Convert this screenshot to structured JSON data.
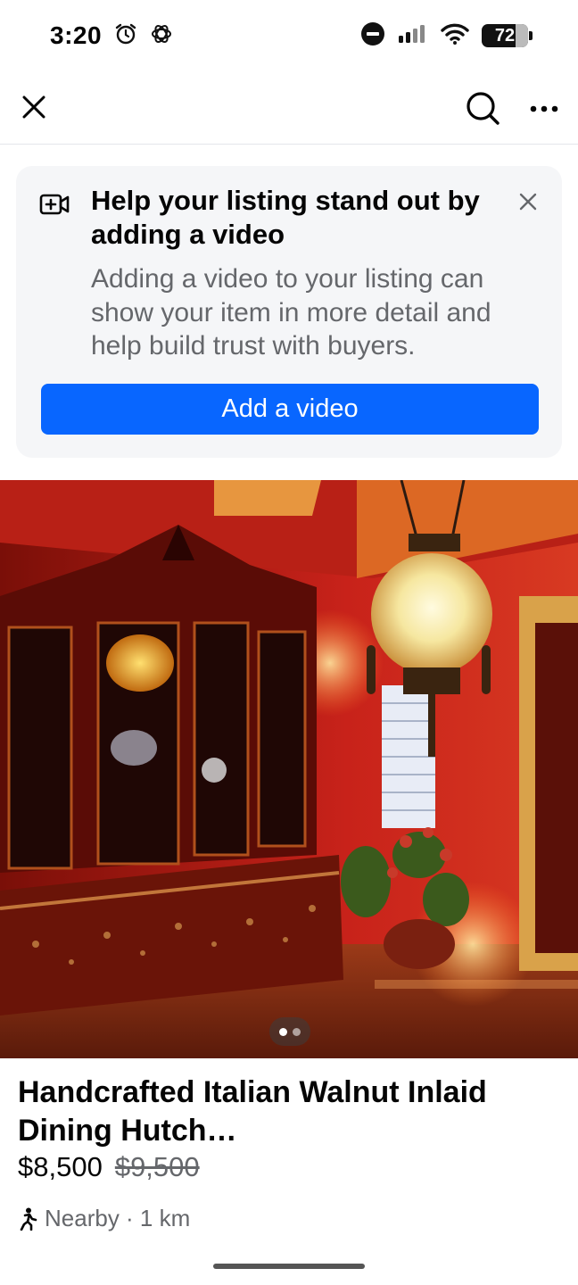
{
  "status_bar": {
    "time": "3:20",
    "battery": "72",
    "icons": [
      "alarm-icon",
      "chatgpt-icon",
      "dnd-icon",
      "signal-icon",
      "wifi-icon",
      "battery-icon"
    ]
  },
  "top_bar": {
    "icons": [
      "close-icon",
      "search-icon",
      "more-icon"
    ]
  },
  "promo": {
    "title": "Help your listing stand out by adding a video",
    "body": "Adding a video to your listing can show your item in more detail and help build trust with buyers.",
    "button_label": "Add a video",
    "icons": [
      "video-add-icon",
      "dismiss-icon"
    ],
    "accent_color": "#0866ff"
  },
  "photo": {
    "description_icon": "listing-photo",
    "page_count": 2,
    "current_page": 1
  },
  "listing": {
    "title": "Handcrafted Italian Walnut Inlaid Dining Hutch…",
    "price": "$8,500",
    "original_price": "$9,500",
    "location": "Nearby · 1 km",
    "location_icon": "walking-person-icon"
  }
}
